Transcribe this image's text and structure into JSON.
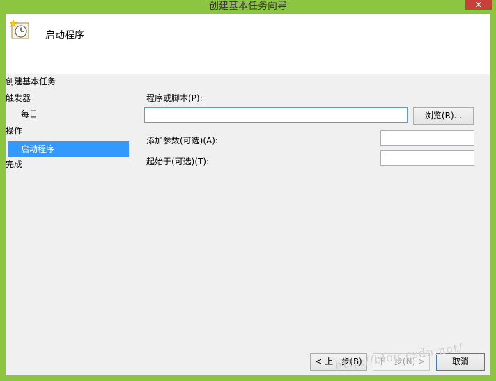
{
  "window": {
    "title": "创建基本任务向导",
    "close_label": "✕"
  },
  "header": {
    "title": "启动程序",
    "icon": "scheduled-task-clock-icon"
  },
  "nav": {
    "items": [
      {
        "label": "创建基本任务",
        "level": 0,
        "selected": false
      },
      {
        "label": "触发器",
        "level": 0,
        "selected": false
      },
      {
        "label": "每日",
        "level": 1,
        "selected": false
      },
      {
        "label": "操作",
        "level": 0,
        "selected": false
      },
      {
        "label": "启动程序",
        "level": 1,
        "selected": true
      },
      {
        "label": "完成",
        "level": 0,
        "selected": false
      }
    ]
  },
  "form": {
    "program_label": "程序或脚本(P):",
    "program_value": "",
    "browse_label": "浏览(R)...",
    "args_label": "添加参数(可选)(A):",
    "args_value": "",
    "start_in_label": "起始于(可选)(T):",
    "start_in_value": ""
  },
  "footer": {
    "back_label": "< 上一步(B)",
    "next_label": "下一步(N) >",
    "cancel_label": "取消"
  },
  "watermark": "http://blog.csdn.net/",
  "colors": {
    "frame": "#8cc641",
    "selection": "#3399ff",
    "close": "#c7403a"
  }
}
